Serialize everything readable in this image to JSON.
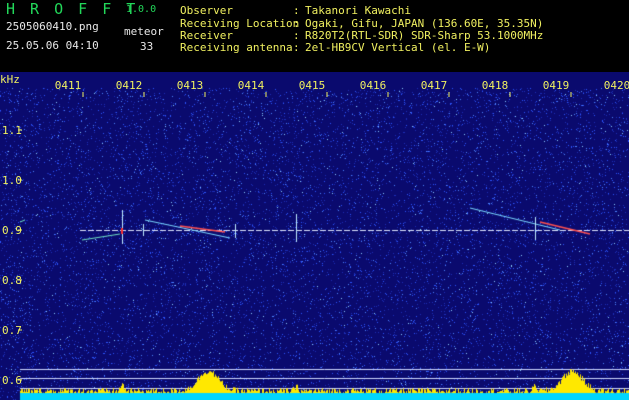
{
  "header": {
    "app_title": "H R O F F T",
    "app_version": "1.0.0",
    "file_name": "2505060410.png",
    "timestamp": "25.05.06 04:10",
    "count_label": "meteor",
    "count_value": "33",
    "info": [
      {
        "label": "Observer",
        "value": "Takanori Kawachi"
      },
      {
        "label": "Receiving Location",
        "value": "Ogaki, Gifu, JAPAN (136.60E, 35.35N)"
      },
      {
        "label": "Receiver",
        "value": "R820T2(RTL-SDR) SDR-Sharp 53.1000MHz"
      },
      {
        "label": "Receiving antenna",
        "value": "2el-HB9CV Vertical (el. E-W)"
      }
    ]
  },
  "axis": {
    "unit": "kHz",
    "time_ticks": [
      "0411",
      "0412",
      "0413",
      "0414",
      "0415",
      "0416",
      "0417",
      "0418",
      "0419",
      "0420"
    ],
    "freq_ticks": [
      "1.1",
      "1.0",
      "0.9",
      "0.8",
      "0.7",
      "0.6"
    ]
  },
  "chart_data": {
    "type": "heatmap",
    "xlabel": "",
    "ylabel": "kHz",
    "x_ticks": [
      "0411",
      "0412",
      "0413",
      "0414",
      "0415",
      "0416",
      "0417",
      "0418",
      "0419",
      "0420"
    ],
    "y_ticks": [
      1.1,
      1.0,
      0.9,
      0.8,
      0.7,
      0.6
    ],
    "ylim": [
      0.58,
      1.16
    ],
    "carrier_khz": 0.9,
    "colors": {
      "background": "#0a0a6e",
      "noise": "#2b4cff",
      "carrier": "#dfe7ff",
      "strong": "#ff3030",
      "level": "#ffe800",
      "level_base": "#00d6ff"
    }
  }
}
